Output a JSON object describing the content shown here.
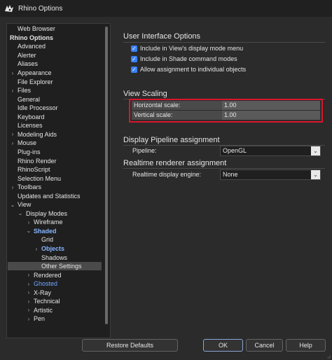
{
  "window": {
    "title": "Rhino Options"
  },
  "tree": {
    "items": [
      {
        "label": "Web Browser",
        "depth": 1,
        "expander": ""
      },
      {
        "label": "Rhino Options",
        "depth": 0,
        "expander": "",
        "bold": true
      },
      {
        "label": "Advanced",
        "depth": 1,
        "expander": ""
      },
      {
        "label": "Alerter",
        "depth": 1,
        "expander": ""
      },
      {
        "label": "Aliases",
        "depth": 1,
        "expander": ""
      },
      {
        "label": "Appearance",
        "depth": 1,
        "expander": "›"
      },
      {
        "label": "File Explorer",
        "depth": 1,
        "expander": ""
      },
      {
        "label": "Files",
        "depth": 1,
        "expander": "›"
      },
      {
        "label": "General",
        "depth": 1,
        "expander": ""
      },
      {
        "label": "Idle Processor",
        "depth": 1,
        "expander": ""
      },
      {
        "label": "Keyboard",
        "depth": 1,
        "expander": ""
      },
      {
        "label": "Licenses",
        "depth": 1,
        "expander": ""
      },
      {
        "label": "Modeling Aids",
        "depth": 1,
        "expander": "›"
      },
      {
        "label": "Mouse",
        "depth": 1,
        "expander": "›"
      },
      {
        "label": "Plug-ins",
        "depth": 1,
        "expander": ""
      },
      {
        "label": "Rhino Render",
        "depth": 1,
        "expander": ""
      },
      {
        "label": "RhinoScript",
        "depth": 1,
        "expander": ""
      },
      {
        "label": "Selection Menu",
        "depth": 1,
        "expander": ""
      },
      {
        "label": "Toolbars",
        "depth": 1,
        "expander": "›"
      },
      {
        "label": "Updates and Statistics",
        "depth": 1,
        "expander": ""
      },
      {
        "label": "View",
        "depth": 1,
        "expander": "⌄"
      },
      {
        "label": "Display Modes",
        "depth": 2,
        "expander": "⌄"
      },
      {
        "label": "Wireframe",
        "depth": 3,
        "expander": "›"
      },
      {
        "label": "Shaded",
        "depth": 3,
        "expander": "⌄",
        "bold": true,
        "blue": true
      },
      {
        "label": "Grid",
        "depth": 4,
        "expander": ""
      },
      {
        "label": "Objects",
        "depth": 4,
        "expander": "›",
        "bold": true,
        "blue": true
      },
      {
        "label": "Shadows",
        "depth": 4,
        "expander": ""
      },
      {
        "label": "Other Settings",
        "depth": 4,
        "expander": "",
        "selected": true
      },
      {
        "label": "Rendered",
        "depth": 3,
        "expander": "›"
      },
      {
        "label": "Ghosted",
        "depth": 3,
        "expander": "›",
        "blue": true
      },
      {
        "label": "X-Ray",
        "depth": 3,
        "expander": "›"
      },
      {
        "label": "Technical",
        "depth": 3,
        "expander": "›"
      },
      {
        "label": "Artistic",
        "depth": 3,
        "expander": "›"
      },
      {
        "label": "Pen",
        "depth": 3,
        "expander": "›"
      }
    ]
  },
  "ui_interface": {
    "title": "User Interface Options",
    "options": [
      {
        "label": "Include in View's display mode menu",
        "checked": true
      },
      {
        "label": "Include in Shade command modes",
        "checked": true
      },
      {
        "label": "Allow assignment to individual objects",
        "checked": true
      }
    ]
  },
  "view_scaling": {
    "title": "View Scaling",
    "horizontal_label": "Horizontal scale:",
    "horizontal_value": "1.00",
    "vertical_label": "Vertical scale:",
    "vertical_value": "1.00",
    "highlight_color": "#d9152b"
  },
  "display_pipeline": {
    "title": "Display Pipeline assignment",
    "pipeline_label": "Pipeline:",
    "pipeline_value": "OpenGL"
  },
  "realtime_renderer": {
    "title": "Realtime renderer assignment",
    "engine_label": "Realtime display engine:",
    "engine_value": "None"
  },
  "buttons": {
    "restore": "Restore Defaults",
    "ok": "OK",
    "cancel": "Cancel",
    "help": "Help"
  },
  "colors": {
    "background": "#2b2b2b",
    "tree_background": "#1f1f1f",
    "accent": "#3b82f6",
    "link_blue": "#6fa8ff"
  }
}
